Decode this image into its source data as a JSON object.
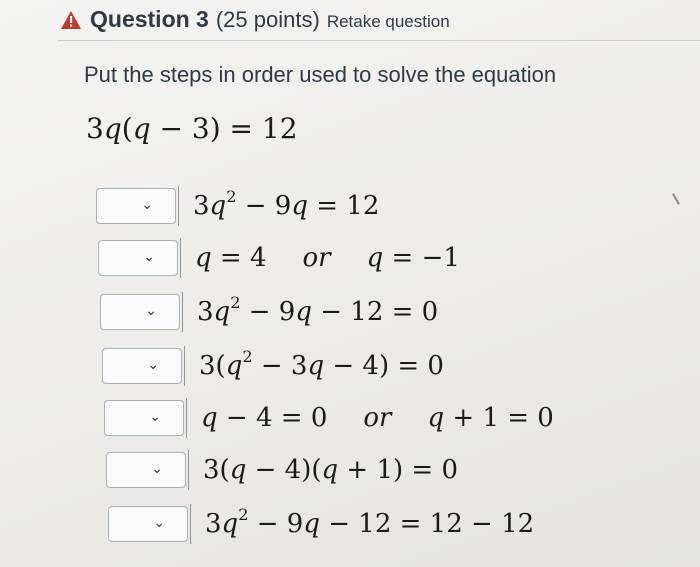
{
  "header": {
    "title": "Question 3",
    "points": "(25 points)",
    "retake": "Retake question",
    "warning_icon": "warning-triangle-icon",
    "warning_color": "#c0392b"
  },
  "prompt": "Put the steps in order used to solve the equation",
  "equation": "3q(q − 3) = 12",
  "steps": [
    "3q² − 9q = 12",
    "q = 4   or   q = −1",
    "3q² − 9q − 12 = 0",
    "3(q² − 3q − 4) = 0",
    "q − 4 = 0   or   q + 1 = 0",
    "3(q − 4)(q + 1) = 0",
    "3q² − 9q − 12 = 12 − 12"
  ],
  "dropdown_icon": "chevron-down-icon"
}
